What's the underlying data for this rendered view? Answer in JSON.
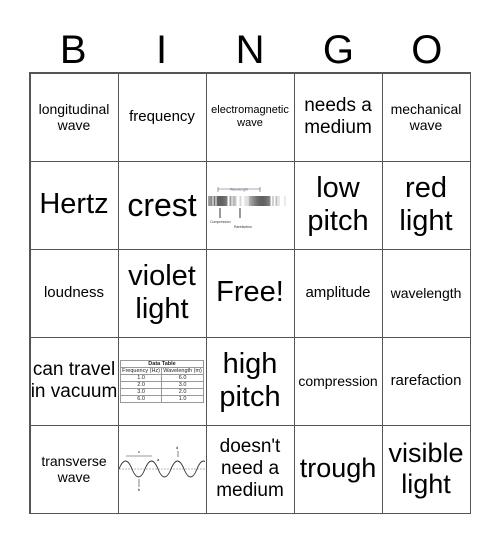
{
  "header": [
    "B",
    "I",
    "N",
    "G",
    "O"
  ],
  "cells": [
    {
      "text": "longitudinal wave",
      "size": "s14"
    },
    {
      "text": "frequency",
      "size": "s15"
    },
    {
      "text": "electromagnetic wave",
      "size": "s11"
    },
    {
      "text": "needs a medium",
      "size": "s19"
    },
    {
      "text": "mechanical wave",
      "size": "s14"
    },
    {
      "text": "Hertz",
      "size": "s29"
    },
    {
      "text": "crest",
      "size": "s32"
    },
    {
      "image": "longitudinal-wave-image",
      "labels": {
        "top": "Wavelength",
        "left": "Compression",
        "right": "Rarefaction"
      }
    },
    {
      "text": "low pitch",
      "size": "s29"
    },
    {
      "text": "red light",
      "size": "s29"
    },
    {
      "text": "loudness",
      "size": "s15"
    },
    {
      "text": "violet light",
      "size": "s29"
    },
    {
      "text": "Free!",
      "size": "s29"
    },
    {
      "text": "amplitude",
      "size": "s15"
    },
    {
      "text": "wavelength",
      "size": "s14"
    },
    {
      "text": "can travel in vacuum",
      "size": "s19"
    },
    {
      "image": "data-table-image",
      "table": {
        "title": "Data Table",
        "headers": [
          "Frequency (Hz)",
          "Wavelength (m)"
        ],
        "rows": [
          [
            "1.0",
            "6.0"
          ],
          [
            "2.0",
            "3.0"
          ],
          [
            "3.0",
            "2.0"
          ],
          [
            "6.0",
            "1.0"
          ]
        ]
      }
    },
    {
      "text": "high pitch",
      "size": "s29"
    },
    {
      "text": "compression",
      "size": "s14"
    },
    {
      "text": "rarefaction",
      "size": "s15"
    },
    {
      "text": "transverse wave",
      "size": "s14"
    },
    {
      "image": "transverse-wave-image",
      "labels": [
        "a",
        "b",
        "c",
        "d"
      ]
    },
    {
      "text": "doesn't need a medium",
      "size": "s19"
    },
    {
      "text": "trough",
      "size": "s27"
    },
    {
      "text": "visible light",
      "size": "s27"
    }
  ]
}
